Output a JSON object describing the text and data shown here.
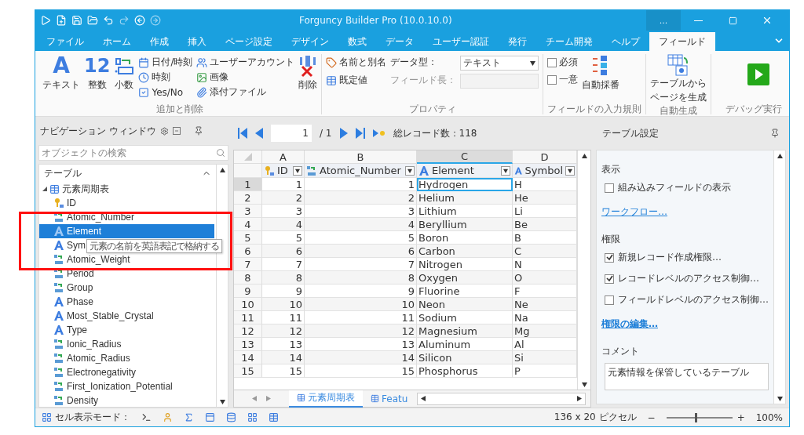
{
  "window": {
    "title": "Forguncy Builder Pro (10.0.10.0)",
    "more": "..."
  },
  "ribbon_tabs": [
    {
      "label": "ファイル",
      "selected": false
    },
    {
      "label": "ホーム",
      "selected": false
    },
    {
      "label": "作成",
      "selected": false
    },
    {
      "label": "挿入",
      "selected": false
    },
    {
      "label": "ページ設定",
      "selected": false
    },
    {
      "label": "デザイン",
      "selected": false
    },
    {
      "label": "数式",
      "selected": false
    },
    {
      "label": "データ",
      "selected": false
    },
    {
      "label": "ユーザー認証",
      "selected": false
    },
    {
      "label": "発行",
      "selected": false
    },
    {
      "label": "チーム開発",
      "selected": false
    },
    {
      "label": "ヘルプ",
      "selected": false
    },
    {
      "label": "フィールド",
      "selected": true
    }
  ],
  "ribbon": {
    "add_delete": {
      "label": "追加と削除",
      "types": [
        {
          "kind": "letter",
          "glyph": "A",
          "label": "テキスト"
        },
        {
          "kind": "number",
          "glyph": "12",
          "label": "整数"
        },
        {
          "kind": "decimal",
          "label": "小数"
        }
      ],
      "small_items": [
        {
          "kind": "calendar",
          "label": "日付/時刻"
        },
        {
          "kind": "clock",
          "label": "時刻"
        },
        {
          "kind": "check",
          "label": "Yes/No"
        },
        {
          "kind": "users",
          "label": "ユーザーアカウント"
        },
        {
          "kind": "image",
          "label": "画像"
        },
        {
          "kind": "clip",
          "label": "添付ファイル"
        }
      ],
      "delete": "削除"
    },
    "properties": {
      "label": "プロパティ",
      "name_alias": "名前と別名",
      "default_value": "既定値",
      "data_type_label": "データ型：",
      "data_type": "テキスト",
      "length_label": "フィールド長：",
      "length_disabled": true
    },
    "input_rules": {
      "label": "フィールドの入力規則",
      "checks": [
        {
          "label": "必須",
          "checked": false
        },
        {
          "label": "一意",
          "checked": false
        }
      ],
      "auto_number": "自動採番"
    },
    "auto_gen": {
      "label": "自動生成",
      "button": [
        "テーブルから",
        "ページを生成"
      ]
    },
    "debug": {
      "label": "デバッグ実行"
    }
  },
  "navigation": {
    "title": "ナビゲーション ウィンドウ",
    "search": {
      "placeholder": "オブジェクトの検索"
    },
    "section": "テーブル",
    "tree": [
      {
        "label": "元素周期表",
        "expanded": true,
        "children": [
          {
            "label": "ID",
            "kind": "key",
            "selected": false
          },
          {
            "label": "Atomic_Number",
            "kind": "number",
            "selected": false
          },
          {
            "label": "Element",
            "kind": "text",
            "selected": true
          },
          {
            "label": "Sym",
            "kind": "text",
            "selected": false
          },
          {
            "label": "Atomic_Weight",
            "kind": "number",
            "selected": false
          },
          {
            "label": "Period",
            "kind": "number",
            "selected": false
          },
          {
            "label": "Group",
            "kind": "number",
            "selected": false
          },
          {
            "label": "Phase",
            "kind": "text",
            "selected": false
          },
          {
            "label": "Most_Stable_Crystal",
            "kind": "text",
            "selected": false
          },
          {
            "label": "Type",
            "kind": "text",
            "selected": false
          },
          {
            "label": "Ionic_Radius",
            "kind": "number",
            "selected": false
          },
          {
            "label": "Atomic_Radius",
            "kind": "number",
            "selected": false
          },
          {
            "label": "Electronegativity",
            "kind": "number",
            "selected": false
          },
          {
            "label": "First_Ionization_Potential",
            "kind": "number",
            "selected": false
          },
          {
            "label": "Density",
            "kind": "number",
            "selected": false
          }
        ]
      }
    ],
    "tooltip": "元素の名前を英語表記で格納する"
  },
  "record_nav": {
    "page": "1",
    "pages": "/ 1",
    "total": "総レコード数：118"
  },
  "grid": {
    "columns": [
      {
        "letter": "A",
        "field": "ID",
        "kind": "key",
        "selected": false
      },
      {
        "letter": "B",
        "field": "Atomic_Number",
        "kind": "number",
        "selected": false
      },
      {
        "letter": "C",
        "field": "Element",
        "kind": "text",
        "selected": true
      },
      {
        "letter": "D",
        "field": "Symbol",
        "kind": "text",
        "selected": false
      }
    ],
    "rows": [
      {
        "n": "1",
        "selected": true,
        "cells": [
          "1",
          "1",
          "Hydrogen",
          "H"
        ]
      },
      {
        "n": "2",
        "selected": false,
        "cells": [
          "2",
          "2",
          "Helium",
          "He"
        ]
      },
      {
        "n": "3",
        "selected": false,
        "cells": [
          "3",
          "3",
          "Lithium",
          "Li"
        ]
      },
      {
        "n": "4",
        "selected": false,
        "cells": [
          "4",
          "4",
          "Beryllium",
          "Be"
        ]
      },
      {
        "n": "5",
        "selected": false,
        "cells": [
          "5",
          "5",
          "Boron",
          "B"
        ]
      },
      {
        "n": "6",
        "selected": false,
        "cells": [
          "6",
          "6",
          "Carbon",
          "C"
        ]
      },
      {
        "n": "7",
        "selected": false,
        "cells": [
          "7",
          "7",
          "Nitrogen",
          "N"
        ]
      },
      {
        "n": "8",
        "selected": false,
        "cells": [
          "8",
          "8",
          "Oxygen",
          "O"
        ]
      },
      {
        "n": "9",
        "selected": false,
        "cells": [
          "9",
          "9",
          "Fluorine",
          "F"
        ]
      },
      {
        "n": "10",
        "selected": false,
        "cells": [
          "10",
          "10",
          "Neon",
          "Ne"
        ]
      },
      {
        "n": "11",
        "selected": false,
        "cells": [
          "11",
          "11",
          "Sodium",
          "Na"
        ]
      },
      {
        "n": "12",
        "selected": false,
        "cells": [
          "12",
          "12",
          "Magnesium",
          "Mg"
        ]
      },
      {
        "n": "13",
        "selected": false,
        "cells": [
          "13",
          "13",
          "Aluminum",
          "Al"
        ]
      },
      {
        "n": "14",
        "selected": false,
        "cells": [
          "14",
          "14",
          "Silicon",
          "Si"
        ]
      },
      {
        "n": "15",
        "selected": false,
        "cells": [
          "15",
          "15",
          "Phosphorus",
          "P"
        ]
      }
    ],
    "sheet_tabs": [
      {
        "label": "元素周期表",
        "selected": true
      },
      {
        "label": "Featu",
        "selected": false
      }
    ]
  },
  "settings": {
    "title": "テーブル設定",
    "items": [
      {
        "kind": "heading",
        "text": "表示"
      },
      {
        "kind": "checkbox",
        "text": "組み込みフィールドの表示",
        "checked": false
      },
      {
        "kind": "link",
        "text": "ワークフロー…",
        "bold": false
      },
      {
        "kind": "heading",
        "text": "権限"
      },
      {
        "kind": "checkbox",
        "text": "新規レコード作成権限…",
        "checked": true
      },
      {
        "kind": "checkbox",
        "text": "レコードレベルのアクセス制御…",
        "checked": true
      },
      {
        "kind": "checkbox",
        "text": "フィールドレベルのアクセス制御…",
        "checked": false
      },
      {
        "kind": "link",
        "text": "権限の編集…",
        "bold": true
      },
      {
        "kind": "heading",
        "text": "コメント"
      },
      {
        "kind": "textarea",
        "text": "元素情報を保管しているテーブル"
      }
    ]
  },
  "status_bar": {
    "mode_label": "セル表示モード：",
    "size": "136 x 20 ピクセル",
    "zoom_out": "−",
    "zoom_in": "+",
    "zoom": {
      "level": 0.45
    },
    "zoom_text": "100%"
  }
}
